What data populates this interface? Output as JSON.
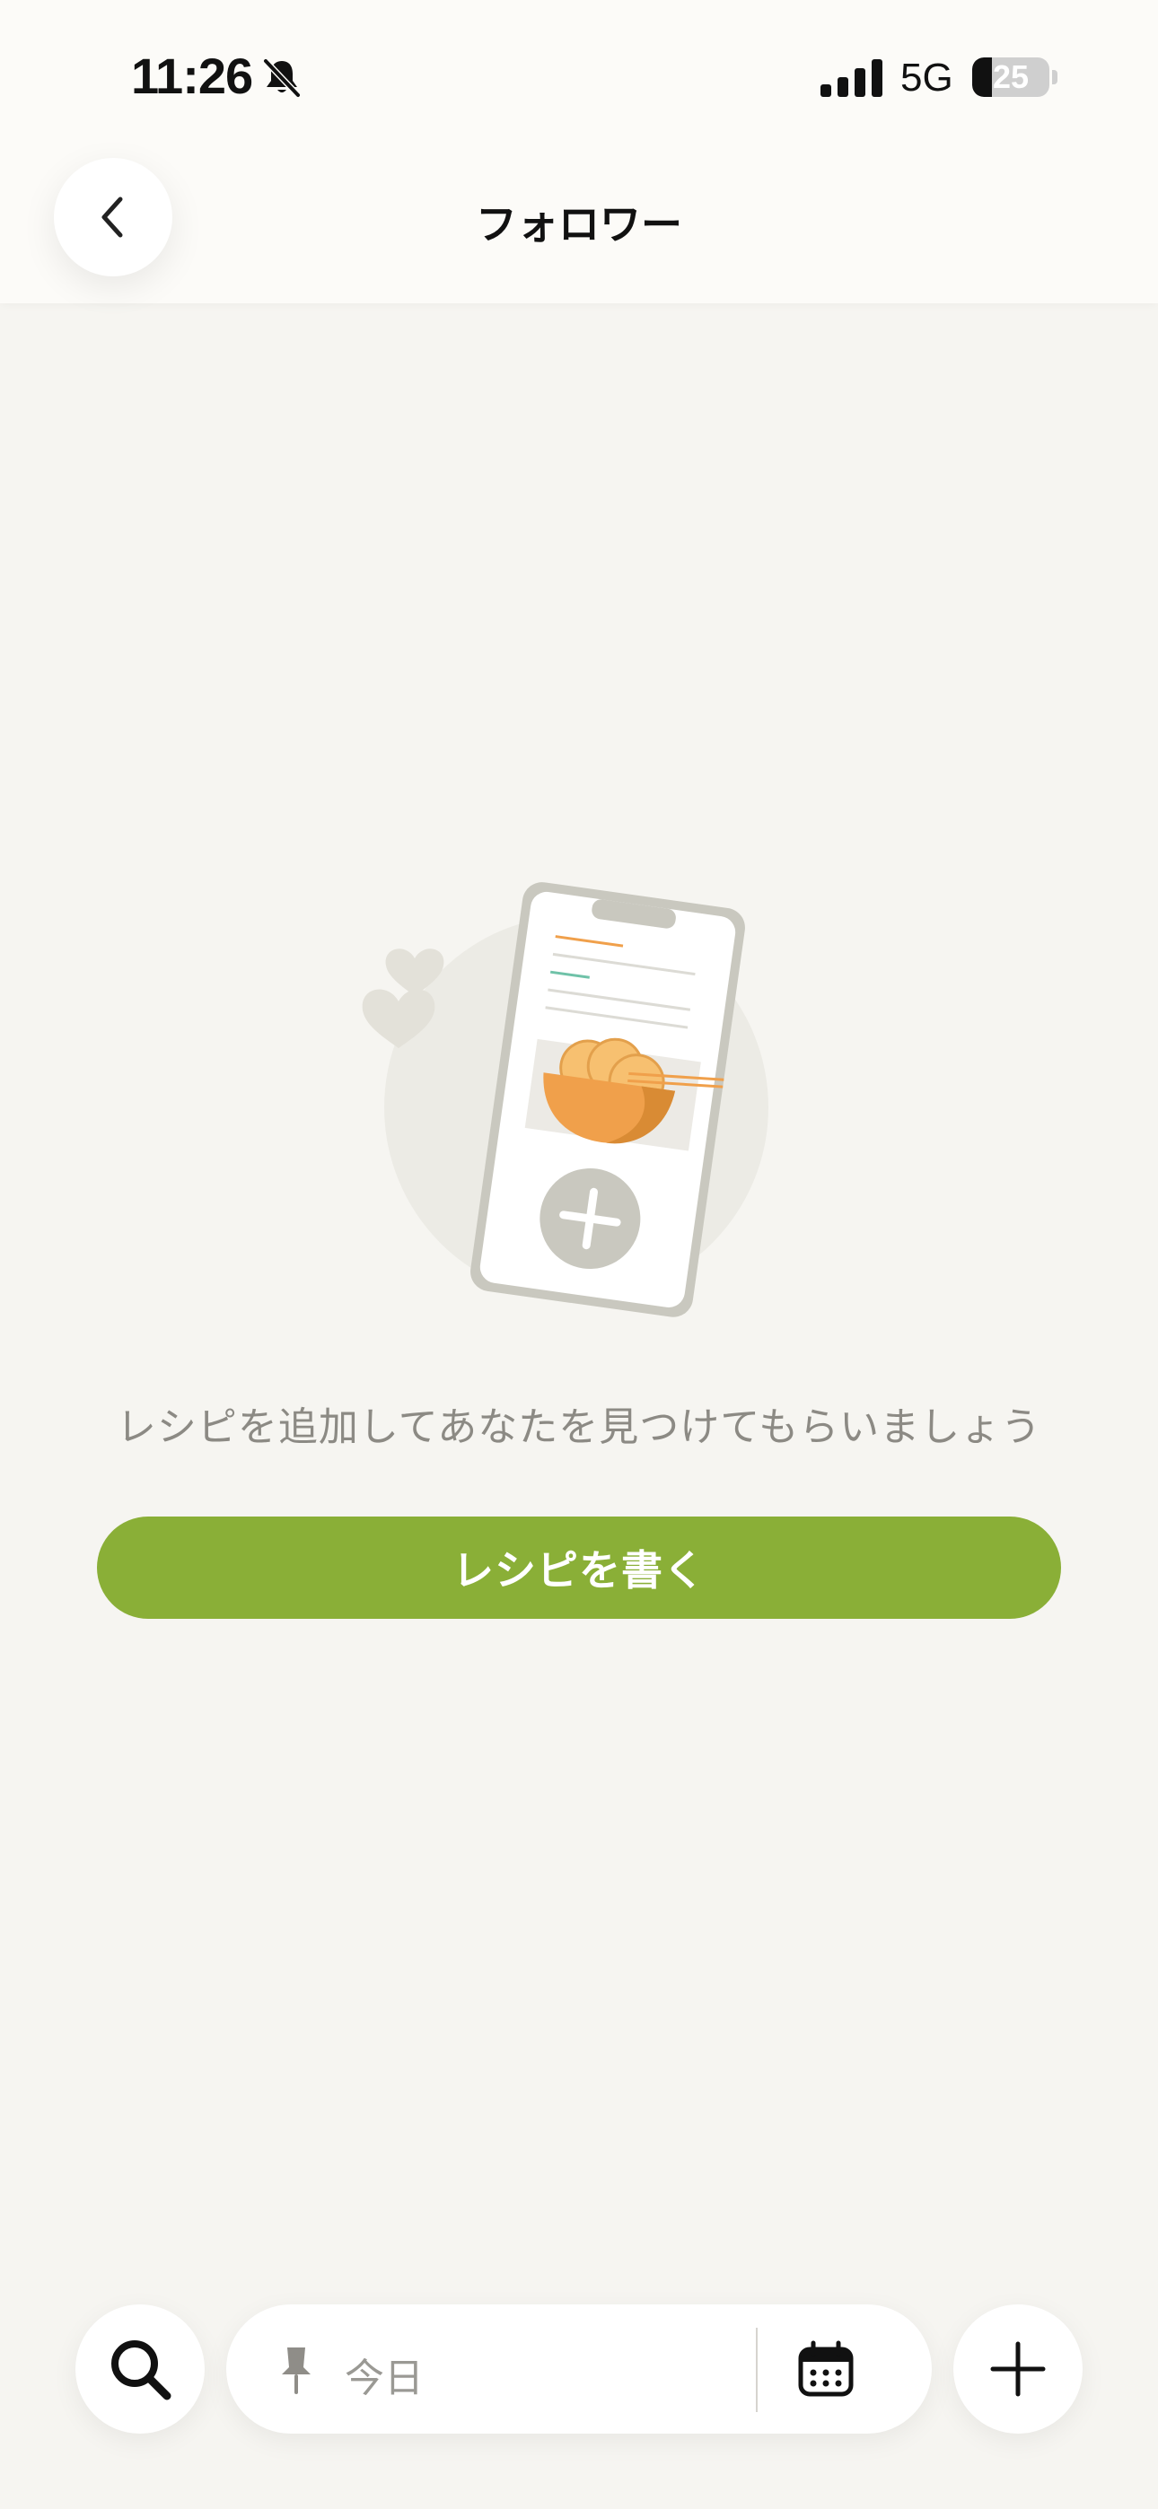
{
  "status_bar": {
    "time": "11:26",
    "network": "5G",
    "battery": "25",
    "battery_fraction": 0.25,
    "icons": [
      "bell-slash-icon",
      "signal-icon",
      "battery-icon"
    ]
  },
  "header": {
    "title": "フォロワー",
    "back_icon": "chevron-left-icon"
  },
  "empty_state": {
    "illustration": "phone-recipe-illustration",
    "message": "レシピを追加してあなたを見つけてもらいましょう",
    "button_label": "レシピを書く"
  },
  "bottom_bar": {
    "search_icon": "search-icon",
    "pin_icon": "pin-icon",
    "plan_date": "今日",
    "calendar_icon": "calendar-icon",
    "add_icon": "plus-icon"
  },
  "colors": {
    "background": "#f6f5f1",
    "accent_green": "#8aaf37",
    "illustration_orange": "#f0a04b",
    "muted_text": "#8c8a84"
  }
}
